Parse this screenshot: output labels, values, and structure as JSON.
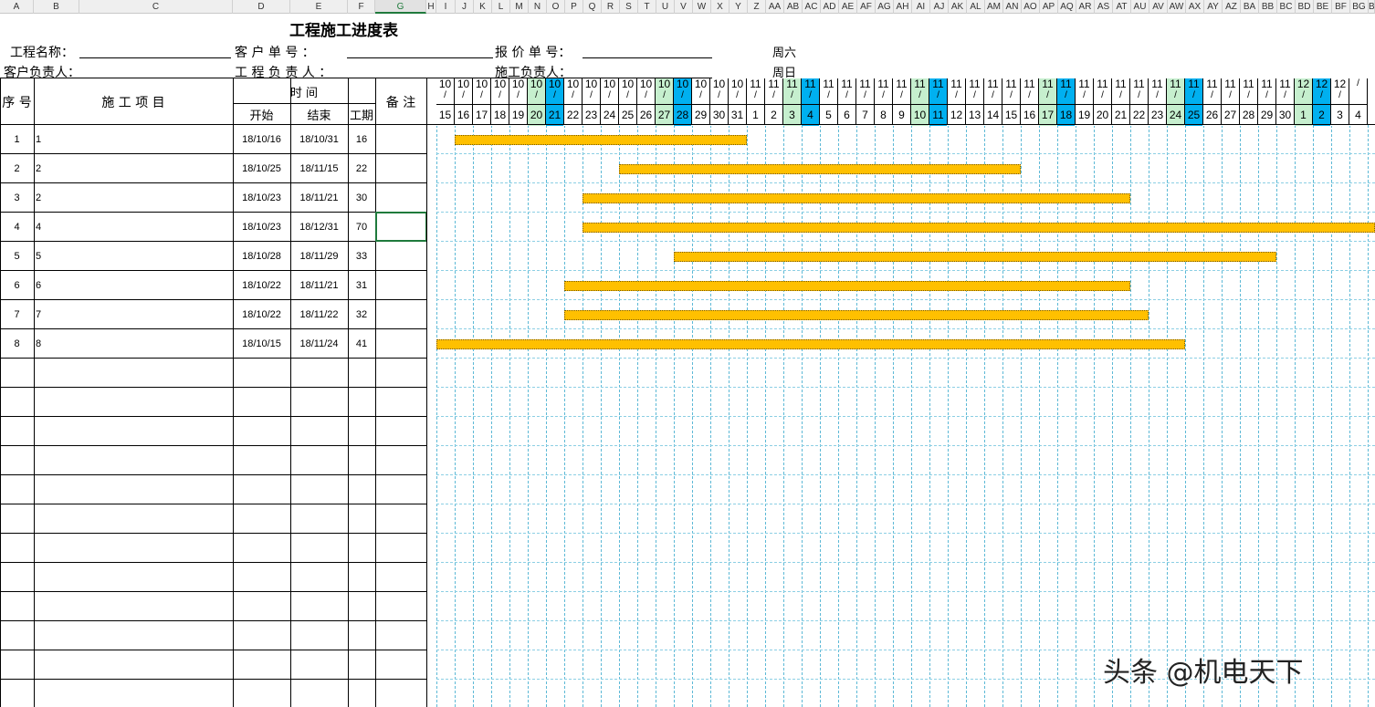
{
  "column_headers": [
    "A",
    "B",
    "C",
    "D",
    "E",
    "F",
    "G",
    "H",
    "I",
    "J",
    "K",
    "L",
    "M",
    "N",
    "O",
    "P",
    "Q",
    "R",
    "S",
    "T",
    "U",
    "V",
    "W",
    "X",
    "Y",
    "Z",
    "AA",
    "AB",
    "AC",
    "AD",
    "AE",
    "AF",
    "AG",
    "AH",
    "AI",
    "AJ",
    "AK",
    "AL",
    "AM",
    "AN",
    "AO",
    "AP",
    "AQ",
    "AR",
    "AS",
    "AT",
    "AU",
    "AV",
    "AW",
    "AX",
    "AY",
    "AZ",
    "BA",
    "BB",
    "BC",
    "BD",
    "BE",
    "BF",
    "BG",
    "B"
  ],
  "selected_column": "G",
  "sheet": {
    "title": "工程施工进度表",
    "info": {
      "project_name_label": "工程名称：",
      "client_no_label": "客 户 单 号 ：",
      "quote_no_label": "报 价 单 号：",
      "weekday_sat": "周六",
      "client_manager_label": "客户负责人：",
      "project_manager_label": "工 程 负 责 人 ：",
      "construction_manager_label": "施工负责人：",
      "weekday_sun": "周日"
    },
    "headers": {
      "seq": "序 号",
      "item": "施 工 项 目",
      "time": "时 间",
      "start": "开始",
      "end": "结束",
      "duration": "工期",
      "remarks": "备 注"
    }
  },
  "rows": [
    {
      "seq": "1",
      "item": "1",
      "start": "18/10/16",
      "end": "18/10/31",
      "duration": "16"
    },
    {
      "seq": "2",
      "item": "2",
      "start": "18/10/25",
      "end": "18/11/15",
      "duration": "22"
    },
    {
      "seq": "3",
      "item": "2",
      "start": "18/10/23",
      "end": "18/11/21",
      "duration": "30"
    },
    {
      "seq": "4",
      "item": "4",
      "start": "18/10/23",
      "end": "18/12/31",
      "duration": "70"
    },
    {
      "seq": "5",
      "item": "5",
      "start": "18/10/28",
      "end": "18/11/29",
      "duration": "33"
    },
    {
      "seq": "6",
      "item": "6",
      "start": "18/10/22",
      "end": "18/11/21",
      "duration": "31"
    },
    {
      "seq": "7",
      "item": "7",
      "start": "18/10/22",
      "end": "18/11/22",
      "duration": "32"
    },
    {
      "seq": "8",
      "item": "8",
      "start": "18/10/15",
      "end": "18/11/24",
      "duration": "41"
    }
  ],
  "gantt": {
    "date_separator": "/",
    "months": [
      "10",
      "10",
      "10",
      "10",
      "10",
      "10",
      "10",
      "10",
      "10",
      "10",
      "10",
      "10",
      "10",
      "10",
      "10",
      "10",
      "10",
      "11",
      "11",
      "11",
      "11",
      "11",
      "11",
      "11",
      "11",
      "11",
      "11",
      "11",
      "11",
      "11",
      "11",
      "11",
      "11",
      "11",
      "11",
      "11",
      "11",
      "11",
      "11",
      "11",
      "11",
      "11",
      "11",
      "11",
      "11",
      "11",
      "11",
      "12",
      "12",
      "12"
    ],
    "days": [
      "15",
      "16",
      "17",
      "18",
      "19",
      "20",
      "21",
      "22",
      "23",
      "24",
      "25",
      "26",
      "27",
      "28",
      "29",
      "30",
      "31",
      "1",
      "2",
      "3",
      "4",
      "5",
      "6",
      "7",
      "8",
      "9",
      "10",
      "11",
      "12",
      "13",
      "14",
      "15",
      "16",
      "17",
      "18",
      "19",
      "20",
      "21",
      "22",
      "23",
      "24",
      "25",
      "26",
      "27",
      "28",
      "29",
      "30",
      "1",
      "2",
      "3",
      "4"
    ],
    "weekend_types": [
      "",
      "",
      "",
      "",
      "",
      "sat",
      "sun",
      "",
      "",
      "",
      "",
      "",
      "sat",
      "sun",
      "",
      "",
      "",
      "",
      "",
      "sat",
      "sun",
      "",
      "",
      "",
      "",
      "",
      "sat",
      "sun",
      "",
      "",
      "",
      "",
      "",
      "sat",
      "sun",
      "",
      "",
      "",
      "",
      "",
      "sat",
      "sun",
      "",
      "",
      "",
      "",
      "",
      "sat",
      "sun",
      "",
      ""
    ],
    "colors": {
      "saturday": "#c6efce",
      "sunday": "#00b0f0",
      "bar": "#ffc000",
      "grid": "#5db9d6"
    }
  },
  "watermark": "头条 @机电天下"
}
